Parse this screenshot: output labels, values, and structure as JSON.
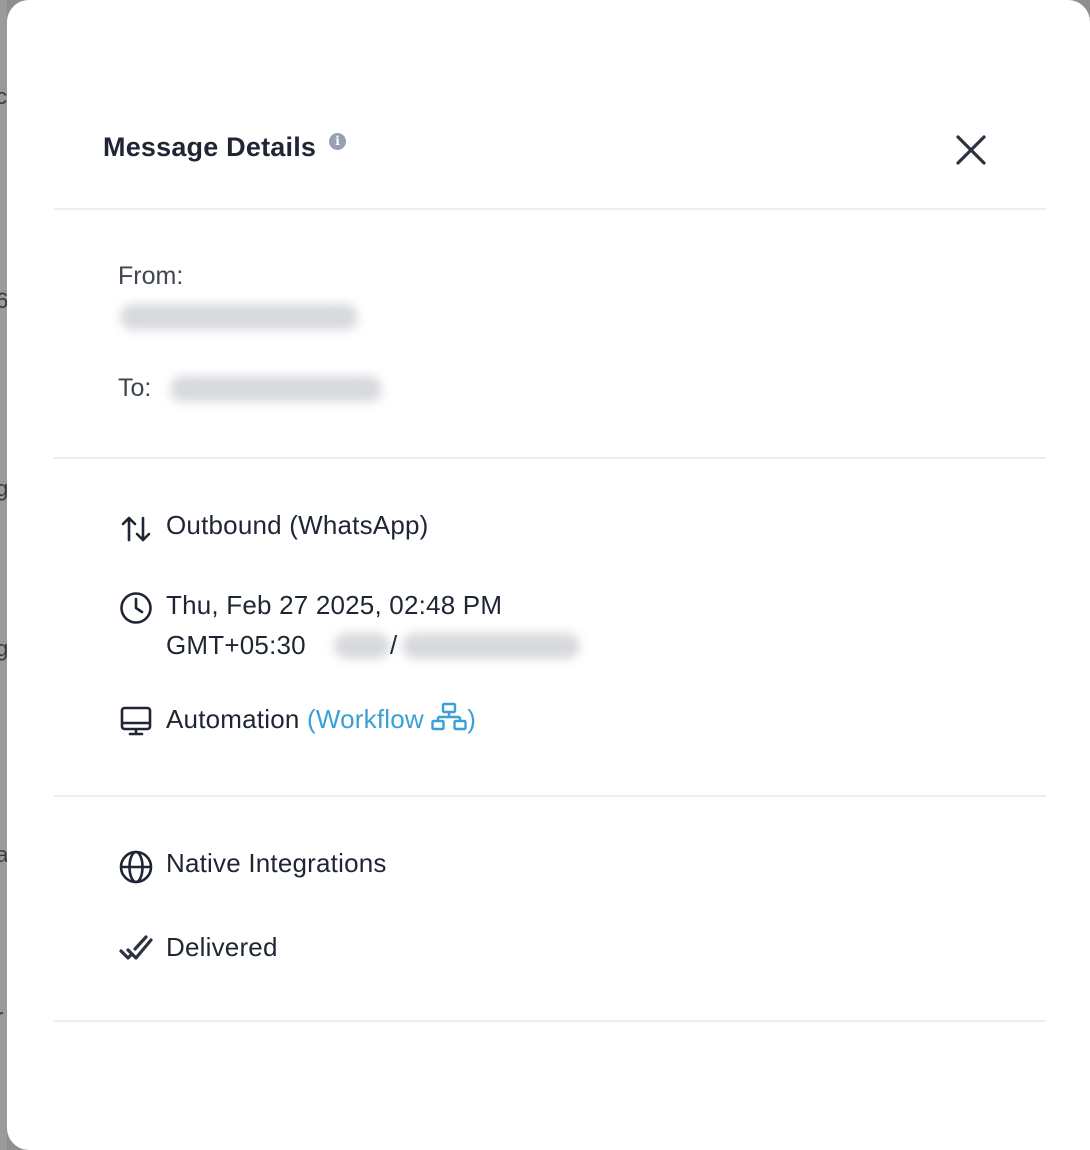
{
  "modal": {
    "title": "Message Details",
    "info_icon": "info-icon",
    "close_icon": "close-icon"
  },
  "addresses": {
    "from_label": "From:",
    "to_label": "To:"
  },
  "details": {
    "direction": "Outbound (WhatsApp)",
    "direction_icon": "arrows-up-down-icon",
    "datetime_line1": "Thu, Feb 27 2025, 02:48 PM",
    "datetime_line2": "GMT+05:30",
    "timezone_separator": "/",
    "clock_icon": "clock-icon",
    "source": "Automation",
    "source_link_open": "(Workflow",
    "source_link_close": ")",
    "monitor_icon": "monitor-icon",
    "workflow_icon": "sitemap-icon"
  },
  "status": {
    "integration": "Native Integrations",
    "globe_icon": "globe-icon",
    "delivery": "Delivered",
    "check_icon": "double-check-icon"
  },
  "colors": {
    "text_primary": "#1f2633",
    "link": "#3aa0d6",
    "divider": "#eceef1",
    "backdrop": "#8f8f8f"
  }
}
